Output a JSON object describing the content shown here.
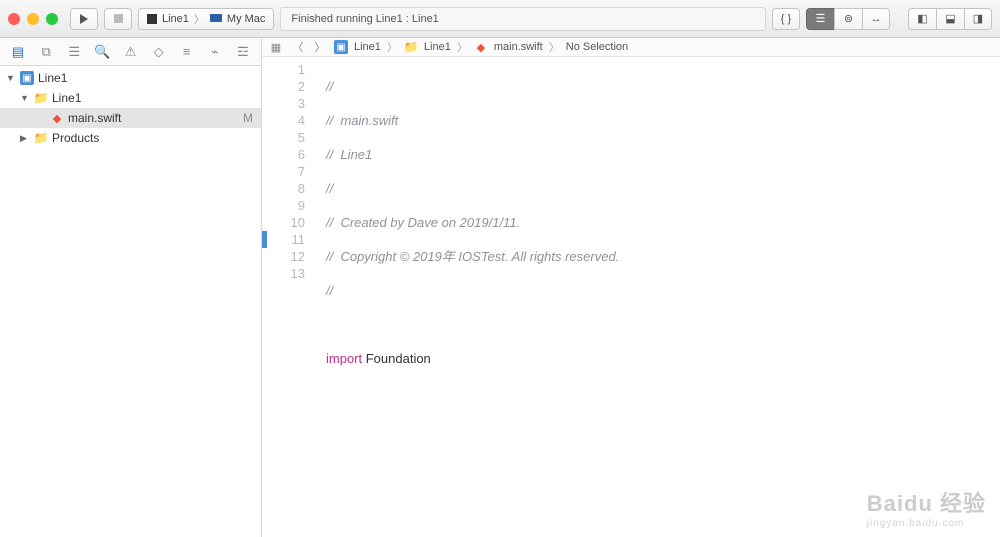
{
  "toolbar": {
    "scheme_name": "Line1",
    "scheme_dest": "My Mac",
    "status": "Finished running Line1 : Line1"
  },
  "navigator": {
    "project": "Line1",
    "group": "Line1",
    "file": "main.swift",
    "file_badge": "M",
    "products": "Products"
  },
  "jumpbar": {
    "c0": "Line1",
    "c1": "Line1",
    "c2": "main.swift",
    "c3": "No Selection"
  },
  "code": {
    "lines": [
      "1",
      "2",
      "3",
      "4",
      "5",
      "6",
      "7",
      "8",
      "9",
      "10",
      "11",
      "12",
      "13"
    ],
    "l1": "//",
    "l2": "//  main.swift",
    "l3": "//  Line1",
    "l4": "//",
    "l5": "//  Created by Dave on 2019/1/11.",
    "l6": "//  Copyright © 2019年 IOSTest. All rights reserved.",
    "l7": "//",
    "l8": "",
    "l9_kw": "import",
    "l9_rest": " Foundation",
    "l10": "",
    "l11": "",
    "l12": "",
    "l13": ""
  },
  "watermark": {
    "brand": "Baidu 经验",
    "sub": "jingyan.baidu.com"
  }
}
